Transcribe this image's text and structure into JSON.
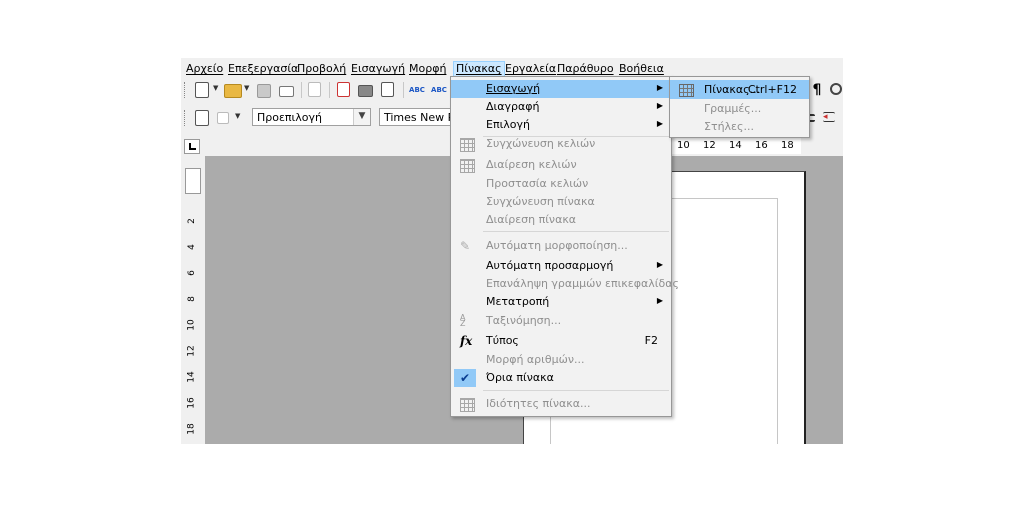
{
  "menubar": {
    "items": [
      "Αρχείο",
      "Επεξεργασία",
      "Προβολή",
      "Εισαγωγή",
      "Μορφή",
      "Πίνακας",
      "Εργαλεία",
      "Παράθυρο",
      "Βοήθεια"
    ],
    "open_item": "Πίνακας"
  },
  "toolbar": {
    "style_value": "Προεπιλογή",
    "font_value": "Times New Ro"
  },
  "ruler": {
    "h_labels": [
      "10",
      "12",
      "14",
      "16",
      "18"
    ],
    "v_labels": [
      "2",
      "4",
      "6",
      "8",
      "10",
      "12",
      "14",
      "16",
      "18"
    ]
  },
  "table_menu": {
    "items": [
      {
        "label": "Εισαγωγή",
        "state": "highlighted",
        "submenu": true
      },
      {
        "label": "Διαγραφή",
        "state": "enabled",
        "submenu": true
      },
      {
        "label": "Επιλογή",
        "state": "enabled",
        "submenu": true
      },
      {
        "label": "Συγχώνευση κελιών",
        "state": "disabled",
        "icon": "merge-cells-icon"
      },
      {
        "label": "Διαίρεση κελιών",
        "state": "disabled",
        "icon": "split-cells-icon"
      },
      {
        "label": "Προστασία κελιών",
        "state": "disabled"
      },
      {
        "label": "Συγχώνευση πίνακα",
        "state": "disabled"
      },
      {
        "label": "Διαίρεση πίνακα",
        "state": "disabled"
      },
      {
        "label": "Αυτόματη μορφοποίηση...",
        "state": "disabled",
        "icon": "autoformat-icon"
      },
      {
        "label": "Αυτόματη προσαρμογή",
        "state": "enabled",
        "submenu": true
      },
      {
        "label": "Επανάληψη γραμμών επικεφαλίδας",
        "state": "disabled"
      },
      {
        "label": "Μετατροπή",
        "state": "enabled",
        "submenu": true
      },
      {
        "label": "Ταξινόμηση...",
        "state": "disabled",
        "icon": "sort-icon"
      },
      {
        "label": "Τύπος",
        "state": "enabled",
        "shortcut": "F2",
        "icon": "formula-icon"
      },
      {
        "label": "Μορφή αριθμών...",
        "state": "disabled"
      },
      {
        "label": "Όρια πίνακα",
        "state": "checked"
      },
      {
        "label": "Ιδιότητες πίνακα...",
        "state": "disabled",
        "icon": "table-properties-icon"
      }
    ]
  },
  "insert_submenu": {
    "items": [
      {
        "label": "Πίνακας...",
        "shortcut": "Ctrl+F12",
        "state": "highlighted",
        "icon": "table-icon"
      },
      {
        "label": "Γραμμές...",
        "state": "disabled"
      },
      {
        "label": "Στήλες...",
        "state": "disabled"
      }
    ]
  },
  "colors": {
    "highlight": "#91c9f7",
    "menubar_open": "#cce8ff",
    "disabled_text": "#8f8f8f",
    "canvas": "#ababab"
  }
}
